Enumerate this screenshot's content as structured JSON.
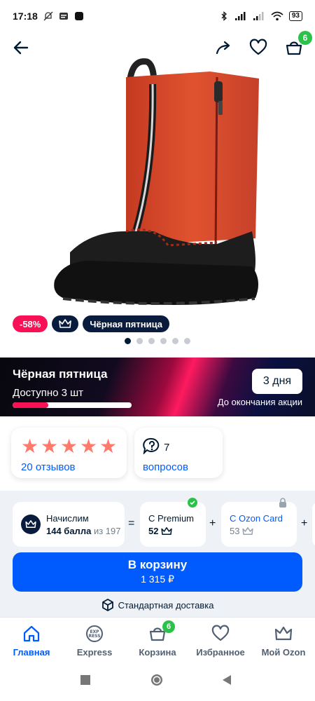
{
  "status_bar": {
    "time": "17:18",
    "battery": "93"
  },
  "top_nav": {
    "cart_badge": "6"
  },
  "badges": {
    "discount": "-58%",
    "black_friday": "Чёрная пятница"
  },
  "gallery": {
    "dot_count": 6,
    "active_index": 0
  },
  "promo_banner": {
    "title": "Чёрная пятница",
    "stock": "Доступно 3 шт",
    "stock_progress": 0.3,
    "days_left": "3 дня",
    "until_text": "До окончания акции"
  },
  "reviews": {
    "stars": 5,
    "reviews_link": "20 отзывов",
    "questions_count": "7",
    "questions_link": "вопросов"
  },
  "bonuses": {
    "accrue_label": "Начислим",
    "accrue_points": "144 балла",
    "accrue_of": "из 197",
    "op_equals": "=",
    "op_plus": "+",
    "premium_label": "С Premium",
    "premium_points": "52",
    "ozon_card_label": "С Ozon Card",
    "ozon_card_points": "53"
  },
  "add_to_cart": {
    "label": "В корзину",
    "price": "1 315 ₽"
  },
  "delivery": {
    "text": "Стандартная доставка"
  },
  "tab_bar": {
    "tabs": [
      {
        "label": "Главная"
      },
      {
        "label": "Express"
      },
      {
        "label": "Корзина",
        "badge": "6"
      },
      {
        "label": "Избранное"
      },
      {
        "label": "Мой Ozon"
      }
    ],
    "active": 0
  },
  "colors": {
    "accent": "#005bff",
    "discount": "#f91155",
    "badge_green": "#2bc24a",
    "dark_navy": "#0a1c3e",
    "star": "#ff7a6b"
  }
}
